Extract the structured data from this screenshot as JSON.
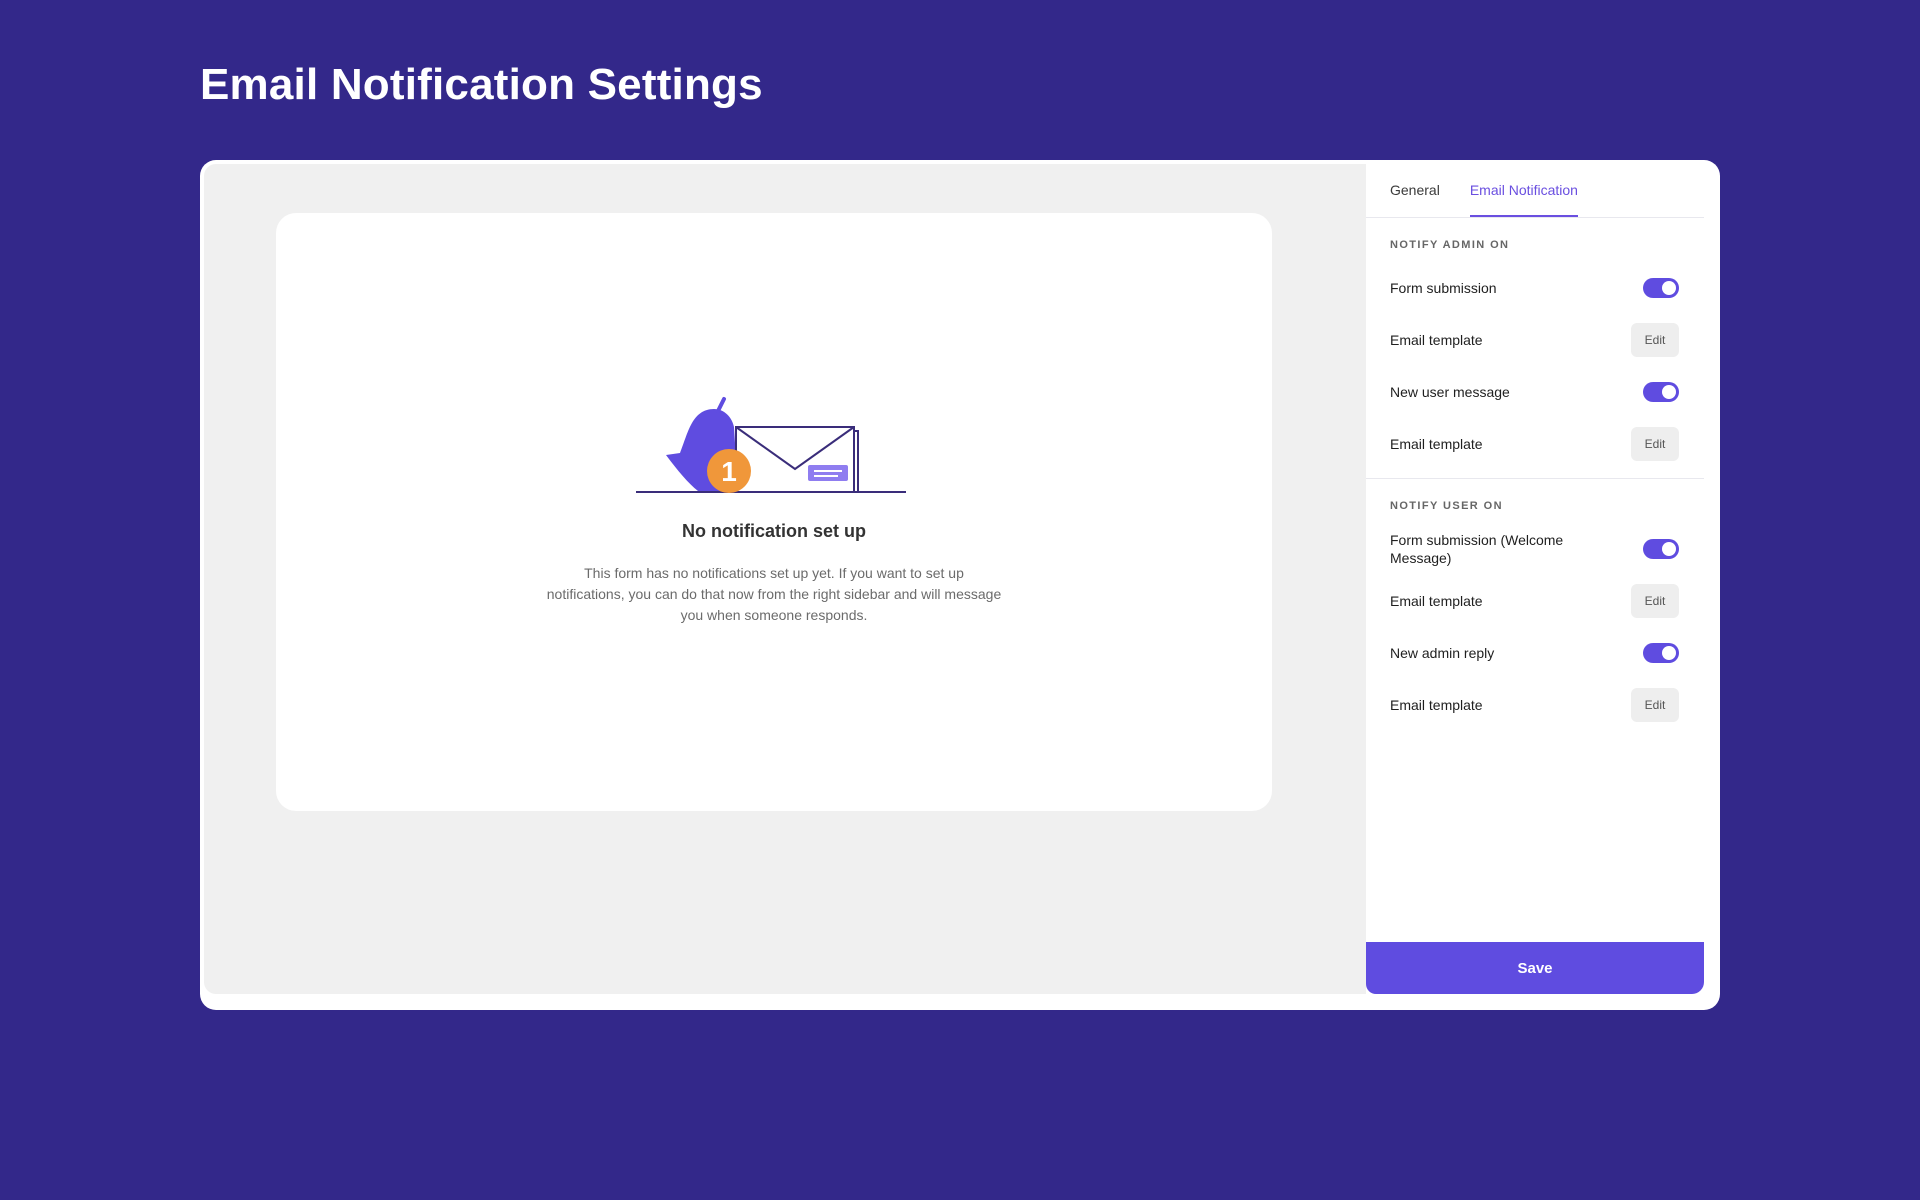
{
  "page": {
    "title": "Email Notification Settings"
  },
  "preview": {
    "empty_title": "No notification set up",
    "empty_text": "This form has no notifications set up yet. If you want to set up notifications, you can do that now from the right sidebar and will message you when someone responds.",
    "badge_count": "1",
    "illustration_icons": [
      "bell-icon",
      "envelope-icon",
      "notification-badge-icon"
    ]
  },
  "sidebar": {
    "tabs": [
      {
        "label": "General",
        "active": false
      },
      {
        "label": "Email Notification",
        "active": true
      }
    ],
    "admin_section": {
      "label": "NOTIFY ADMIN ON",
      "rows": [
        {
          "label": "Form submission",
          "control": "toggle",
          "on": true
        },
        {
          "label": "Email template",
          "control": "button",
          "button_label": "Edit"
        },
        {
          "label": "New user message",
          "control": "toggle",
          "on": true
        },
        {
          "label": "Email template",
          "control": "button",
          "button_label": "Edit"
        }
      ]
    },
    "user_section": {
      "label": "NOTIFY USER ON",
      "rows": [
        {
          "label": "Form submission (Welcome Message)",
          "control": "toggle",
          "on": true
        },
        {
          "label": "Email template",
          "control": "button",
          "button_label": "Edit"
        },
        {
          "label": "New admin reply",
          "control": "toggle",
          "on": true
        },
        {
          "label": "Email template",
          "control": "button",
          "button_label": "Edit"
        }
      ]
    },
    "save_label": "Save"
  },
  "colors": {
    "background": "#33288a",
    "accent": "#5f4ce0",
    "badge": "#f0973a",
    "canvas": "#f0f0f0"
  }
}
